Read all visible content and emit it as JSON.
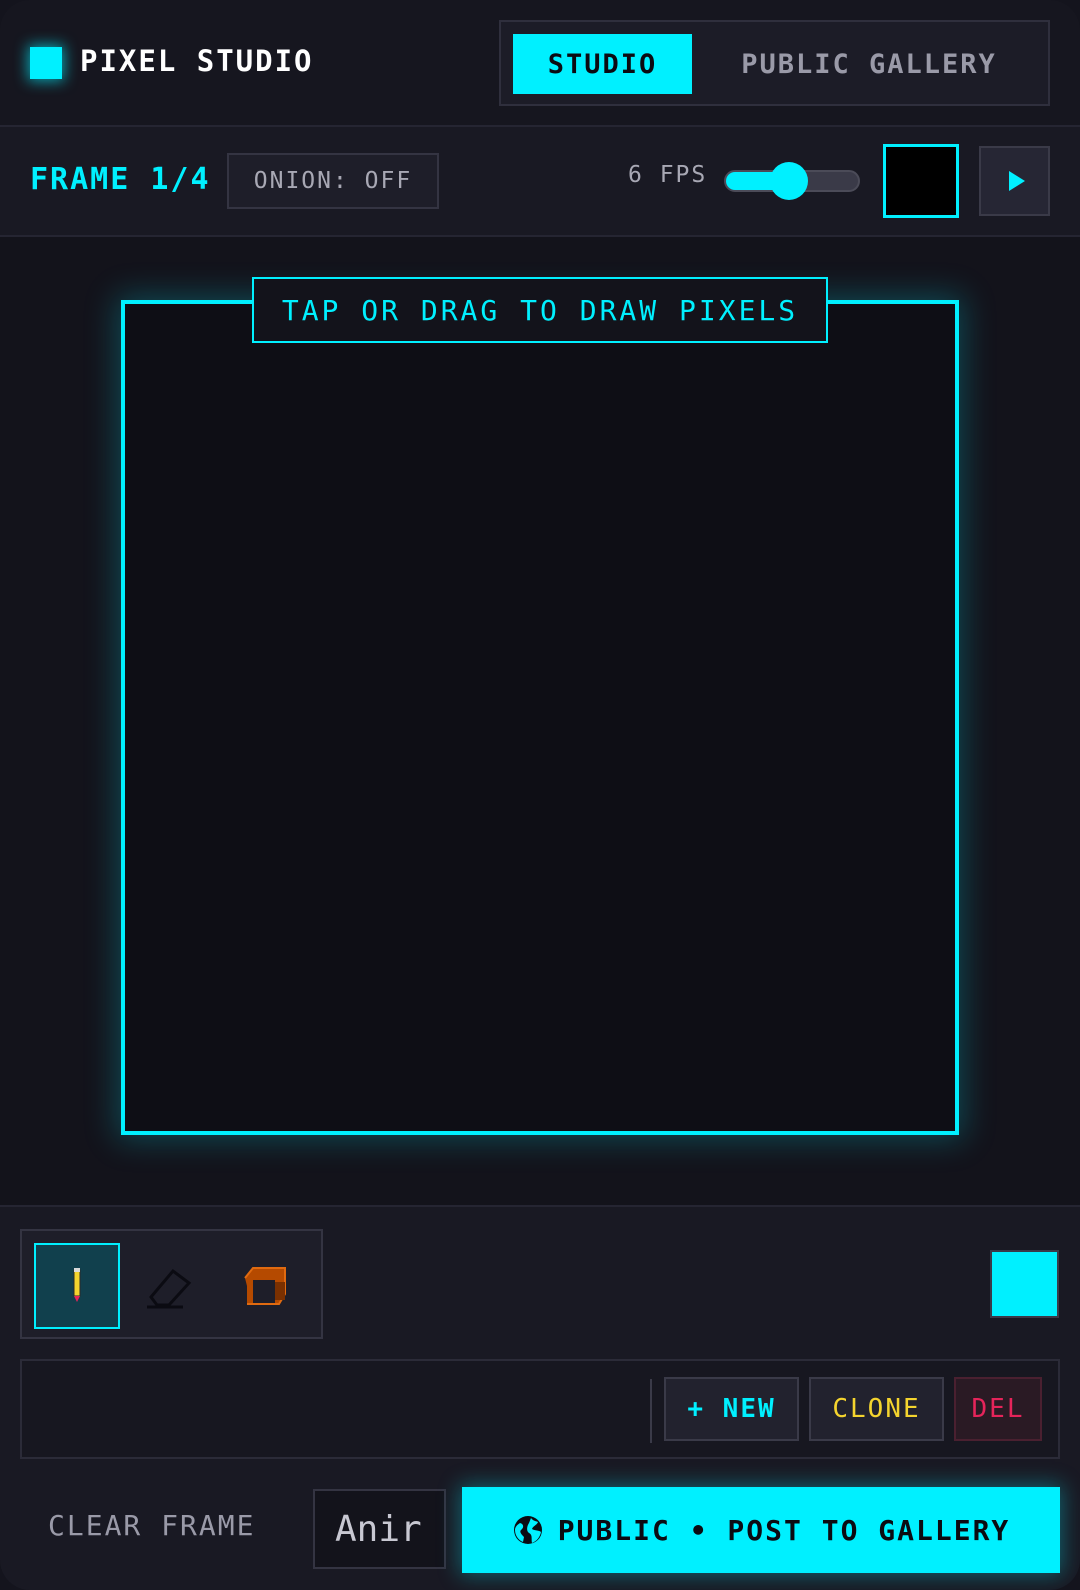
{
  "app": {
    "title": "PIXEL STUDIO"
  },
  "tabs": [
    {
      "label": "STUDIO",
      "active": true
    },
    {
      "label": "PUBLIC GALLERY",
      "active": false
    }
  ],
  "toolbar": {
    "frame_label": "FRAME 1/4",
    "onion_label": "ONION: OFF",
    "fps_label": "6 FPS",
    "fps_slider_fraction": 0.45,
    "current_color": "#000000"
  },
  "canvas": {
    "hint": "TAP OR DRAG TO DRAW PIXELS"
  },
  "tools": [
    {
      "name": "pencil",
      "icon": "pencil-icon",
      "active": true
    },
    {
      "name": "eraser",
      "icon": "eraser-icon",
      "active": false
    },
    {
      "name": "bucket",
      "icon": "paint-bucket-icon",
      "active": false
    }
  ],
  "active_color": "#00f0ff",
  "frames": {
    "new_label": "+ NEW",
    "clone_label": "CLONE",
    "del_label": "DEL"
  },
  "footer": {
    "clear_label": "CLEAR FRAME",
    "name_value": "Anir",
    "post_label": "PUBLIC • POST TO GALLERY"
  },
  "colors": {
    "accent": "#00f0ff",
    "clone": "#f4d42e",
    "delete": "#e5245a"
  }
}
